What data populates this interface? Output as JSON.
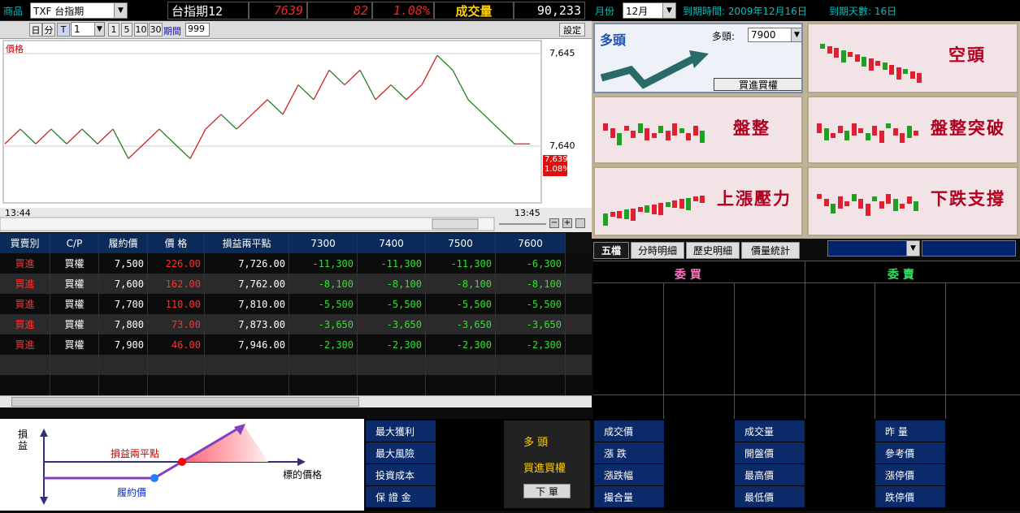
{
  "topbar": {
    "product_label": "商品",
    "product_value": "TXF 台指期",
    "name": "台指期12",
    "price": "7639",
    "change": "82",
    "percent": "1.08%",
    "volume_label": "成交量",
    "volume": "90,233"
  },
  "chart_toolbar": {
    "btn_day": "日",
    "btn_min": "分",
    "btn_tick": "T",
    "interval_value": "1",
    "i1": "1",
    "i5": "5",
    "i10": "10",
    "i30": "30",
    "period_label": "期間",
    "period_value": "999",
    "settings": "設定"
  },
  "chart": {
    "ylabel": "價格",
    "tick_high": "7,645",
    "tick_mid": "7,640",
    "last_price": "7,639",
    "last_pct": "1.08%",
    "time_start": "13:44",
    "time_end": "13:45"
  },
  "chart_data": {
    "type": "line",
    "ylim": [
      7635,
      7646
    ],
    "values": [
      7639,
      7640,
      7639,
      7640,
      7639,
      7640,
      7639,
      7640,
      7638,
      7639,
      7640,
      7639,
      7638,
      7640,
      7641,
      7640,
      7641,
      7642,
      7641,
      7643,
      7642,
      7644,
      7643,
      7644,
      7642,
      7643,
      7642,
      7643,
      7645,
      7644,
      7642,
      7641,
      7640,
      7639,
      7639
    ]
  },
  "right_top": {
    "month_label": "月份",
    "month_value": "12月",
    "expiry": "到期時間: 2009年12月16日",
    "days": "到期天數: 16日"
  },
  "strategies": {
    "bull_title": "多頭",
    "bull_select_label": "多頭:",
    "bull_select_value": "7900",
    "bull_button": "買進買權",
    "bear": "空頭",
    "consol": "盤整",
    "breakout": "盤整突破",
    "resist": "上漲壓力",
    "support": "下跌支撐"
  },
  "table": {
    "headers": [
      "買賣別",
      "C/P",
      "履約價",
      "價 格",
      "損益兩平點",
      "7300",
      "7400",
      "7500",
      "7600"
    ],
    "rows": [
      [
        "買進",
        "買權",
        "7,500",
        "226.00",
        "7,726.00",
        "-11,300",
        "-11,300",
        "-11,300",
        "-6,300"
      ],
      [
        "買進",
        "買權",
        "7,600",
        "162.00",
        "7,762.00",
        "-8,100",
        "-8,100",
        "-8,100",
        "-8,100"
      ],
      [
        "買進",
        "買權",
        "7,700",
        "110.00",
        "7,810.00",
        "-5,500",
        "-5,500",
        "-5,500",
        "-5,500"
      ],
      [
        "買進",
        "買權",
        "7,800",
        "73.00",
        "7,873.00",
        "-3,650",
        "-3,650",
        "-3,650",
        "-3,650"
      ],
      [
        "買進",
        "買權",
        "7,900",
        "46.00",
        "7,946.00",
        "-2,300",
        "-2,300",
        "-2,300",
        "-2,300"
      ]
    ]
  },
  "diagram": {
    "y_label": "損益",
    "breakeven": "損益兩平點",
    "underlying": "標的價格",
    "strike": "履約價"
  },
  "summary": {
    "max_profit": "最大獲利",
    "max_risk": "最大風險",
    "cost": "投資成本",
    "margin": "保 證 金",
    "mid_title": "多 頭",
    "mid_sub": "買進買權",
    "order": "下 單"
  },
  "quotes": {
    "l1": "成交價",
    "l2": "漲 跌",
    "l3": "漲跌幅",
    "l4": "撮合量",
    "m1": "成交量",
    "m2": "開盤價",
    "m3": "最高價",
    "m4": "最低價",
    "r1": "昨 量",
    "r2": "參考價",
    "r3": "漲停價",
    "r4": "跌停價"
  },
  "five": {
    "tab1": "五檔",
    "tab2": "分時明細",
    "tab3": "歷史明細",
    "tab4": "價量統計",
    "buy": "委 買",
    "sell": "委 賣"
  },
  "colors": {
    "up": "#ff2020",
    "down": "#20c020",
    "accent": "#ffd000",
    "panel": "#0a2a6a"
  }
}
